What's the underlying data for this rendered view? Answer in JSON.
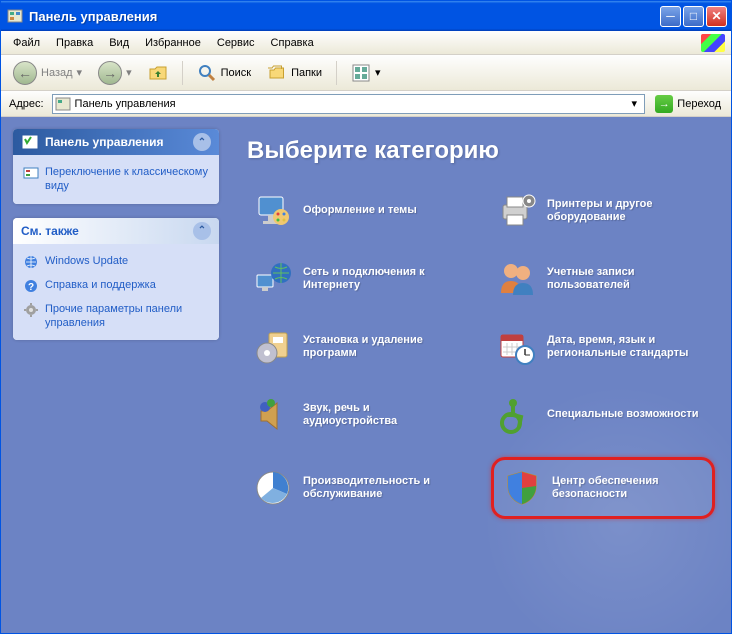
{
  "window": {
    "title": "Панель управления"
  },
  "menu": {
    "file": "Файл",
    "edit": "Правка",
    "view": "Вид",
    "favorites": "Избранное",
    "tools": "Сервис",
    "help": "Справка"
  },
  "toolbar": {
    "back": "Назад",
    "search": "Поиск",
    "folders": "Папки"
  },
  "address": {
    "label": "Адрес:",
    "value": "Панель управления",
    "go": "Переход"
  },
  "sidebar": {
    "panel1": {
      "title": "Панель управления",
      "switch": "Переключение к классическому виду"
    },
    "panel2": {
      "title": "См. также",
      "links": [
        {
          "label": "Windows Update"
        },
        {
          "label": "Справка и поддержка"
        },
        {
          "label": "Прочие параметры панели управления"
        }
      ]
    }
  },
  "main": {
    "heading": "Выберите категорию",
    "categories": [
      {
        "label": "Оформление и темы"
      },
      {
        "label": "Принтеры и другое оборудование"
      },
      {
        "label": "Сеть и подключения к Интернету"
      },
      {
        "label": "Учетные записи пользователей"
      },
      {
        "label": "Установка и удаление программ"
      },
      {
        "label": "Дата, время, язык и региональные стандарты"
      },
      {
        "label": "Звук, речь и аудиоустройства"
      },
      {
        "label": "Специальные возможности"
      },
      {
        "label": "Производительность и обслуживание"
      },
      {
        "label": "Центр обеспечения безопасности"
      }
    ]
  }
}
